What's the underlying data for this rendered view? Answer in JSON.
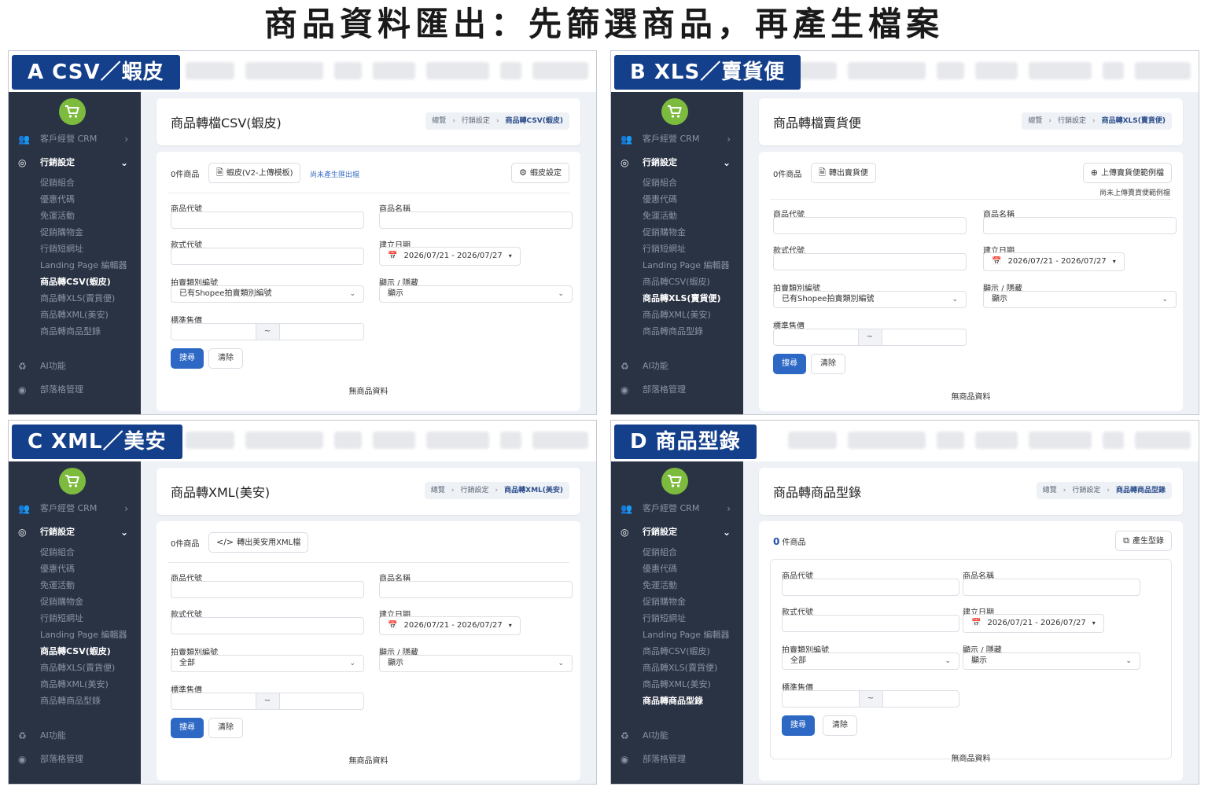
{
  "page_title": "商品資料匯出：先篩選商品，再產生檔案",
  "menu": {
    "crm": "客戶經營 CRM",
    "marketing": "行銷設定",
    "sub": [
      "促銷組合",
      "優惠代碼",
      "免運活動",
      "促銷購物金",
      "行銷短網址",
      "Landing Page 編輯器",
      "商品轉CSV(蝦皮)",
      "商品轉XLS(賣貨便)",
      "商品轉XML(美安)",
      "商品轉商品型錄"
    ],
    "ai": "AI功能",
    "blog": "部落格管理"
  },
  "common": {
    "breadcrumb_home": "總覽",
    "breadcrumb_section": "行銷設定",
    "count_zero_items": "0件商品",
    "field_product_code": "商品代號",
    "field_product_name": "商品名稱",
    "field_style_code": "款式代號",
    "field_created_date": "建立日期",
    "date_range": "2026/07/21 - 2026/07/27",
    "field_auction_category": "拍賣類別編號",
    "field_visibility": "顯示 / 隱藏",
    "visibility_value": "顯示",
    "field_price": "標準售價",
    "range_sep": "~",
    "search": "搜尋",
    "clear": "清除",
    "empty": "無商品資料"
  },
  "panel_a": {
    "tag": "A CSV／蝦皮",
    "title": "商品轉檔CSV(蝦皮)",
    "crumb_current": "商品轉CSV(蝦皮)",
    "template_button": "蝦皮(V2-上傳模板)",
    "hint": "尚未產生匯出檔",
    "settings_button": "蝦皮設定",
    "category_value": "已有Shopee拍賣類別編號"
  },
  "panel_b": {
    "tag": "B XLS／賣貨便",
    "title": "商品轉檔賣貨便",
    "crumb_current": "商品轉XLS(賣貨便)",
    "export_button": "轉出賣貨便",
    "upload_button": "上傳賣貨便範例檔",
    "upload_note": "尚未上傳賣貨便範例檔",
    "category_value": "已有Shopee拍賣類別編號"
  },
  "panel_c": {
    "tag": "C XML／美安",
    "title": "商品轉XML(美安)",
    "crumb_current": "商品轉XML(美安)",
    "export_button": "轉出美安用XML檔",
    "category_value": "全部"
  },
  "panel_d": {
    "tag": "D 商品型錄",
    "title": "商品轉商品型錄",
    "crumb_current": "商品轉商品型錄",
    "count_number": "0",
    "count_suffix": "件商品",
    "generate_button": "產生型錄",
    "category_value": "全部"
  },
  "colors": {
    "tag_bg": "#143f8a",
    "sidebar_bg": "#2a3344",
    "primary_button": "#2e68c5",
    "logo_green": "#7dbb3f"
  }
}
